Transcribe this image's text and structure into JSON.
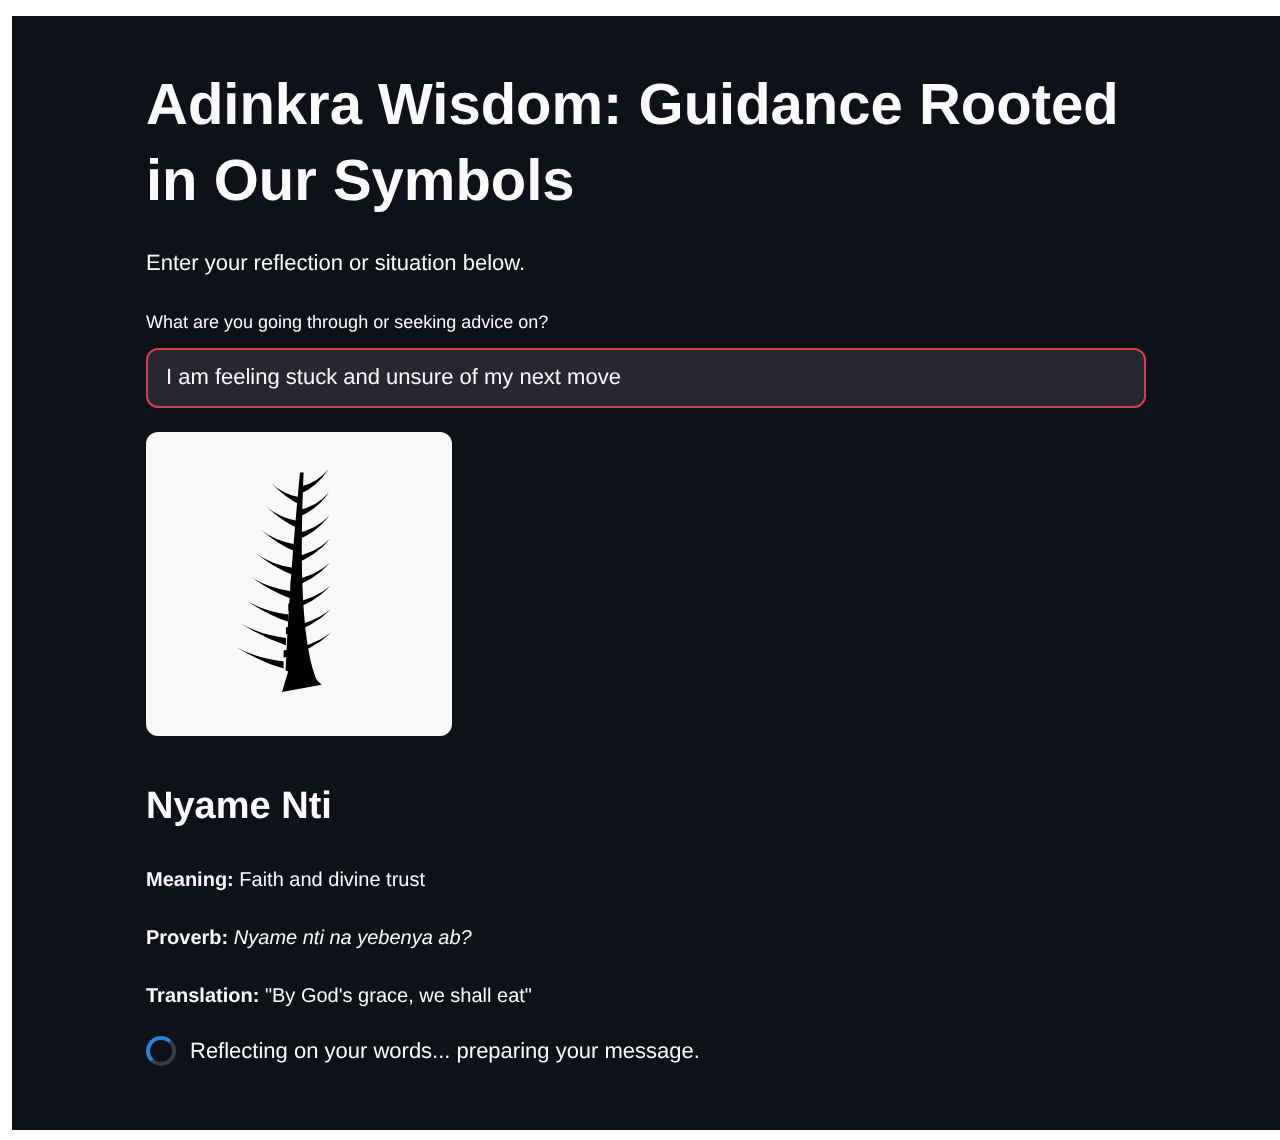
{
  "title": "Adinkra Wisdom: Guidance Rooted in Our Symbols",
  "intro": "Enter your reflection or situation below.",
  "input": {
    "label": "What are you going through or seeking advice on?",
    "value": "I am feeling stuck and unsure of my next move",
    "focused": true
  },
  "symbol": {
    "name": "Nyame Nti",
    "details": [
      "**Meaning:** Faith and divine trust",
      "**Proverb:** *Nyame nti na yebenya ab?*",
      "**Translation:** \"By God's grace, we shall eat\""
    ]
  },
  "status": {
    "text": "Reflecting on your words... preparing your message.",
    "loading": true
  }
}
